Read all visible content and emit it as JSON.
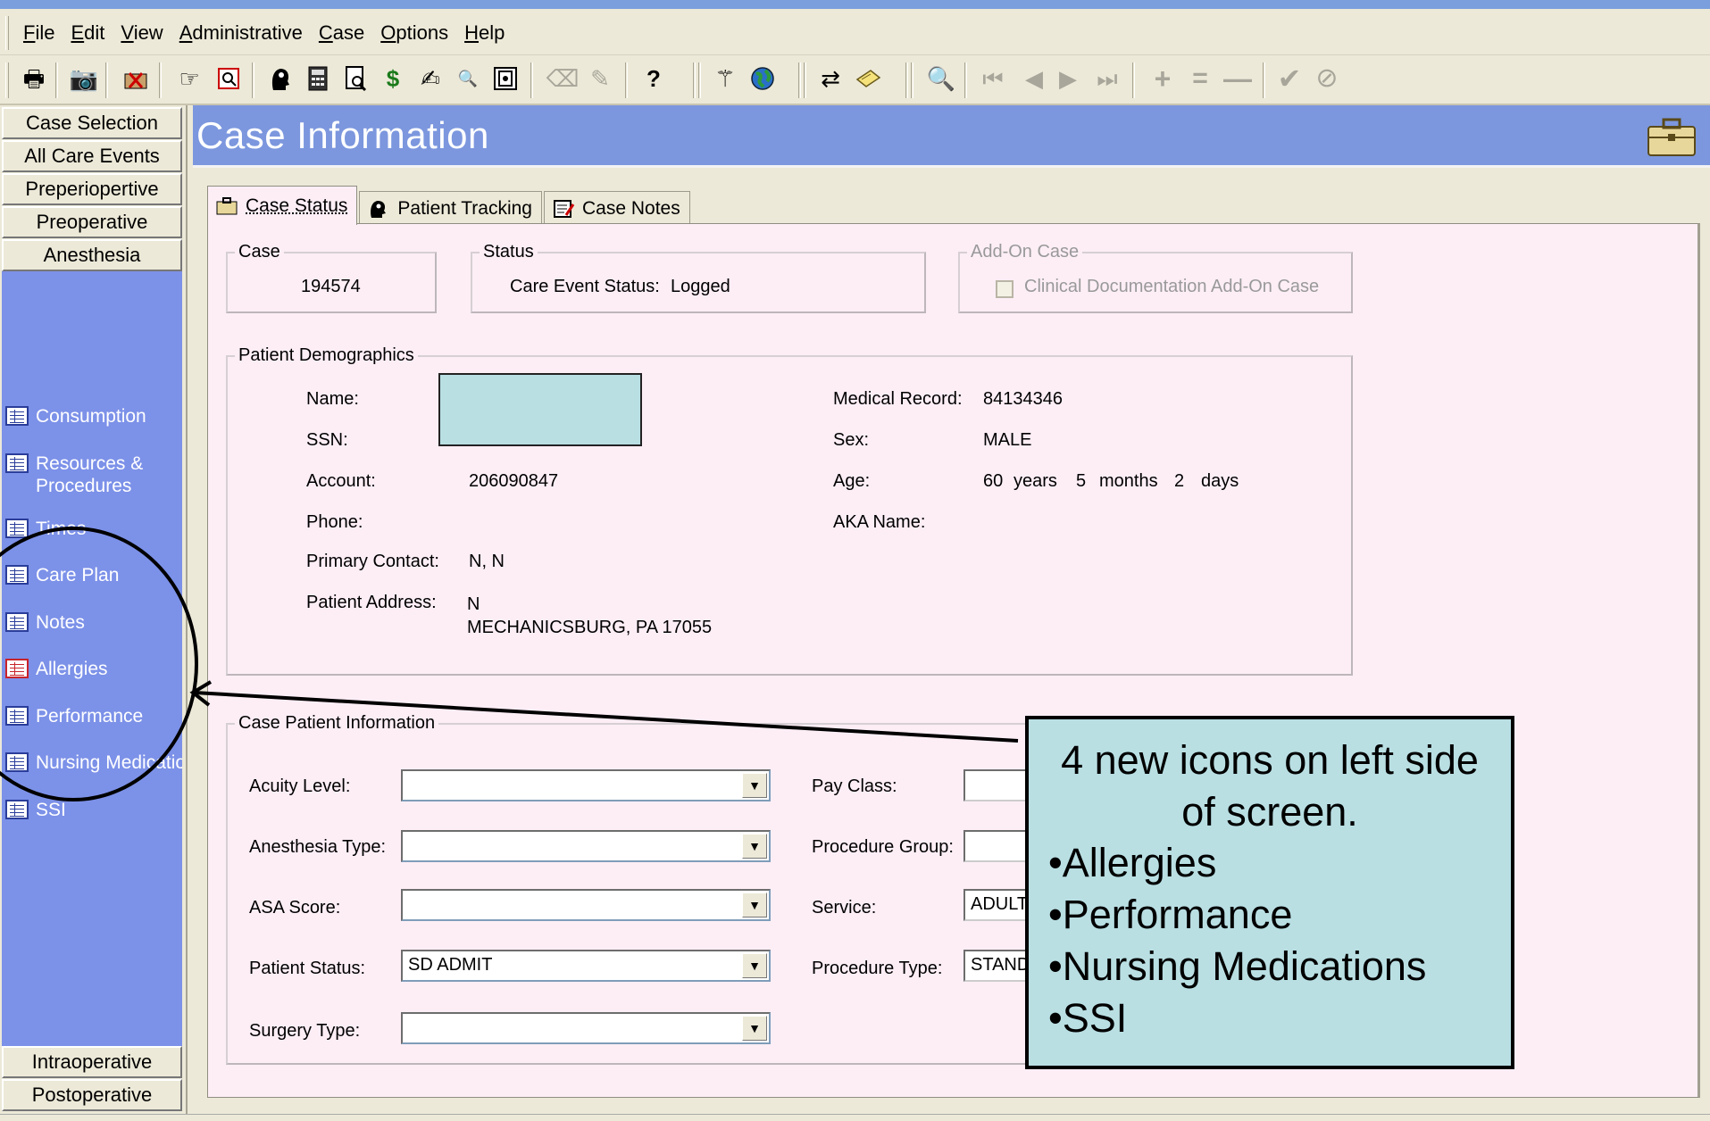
{
  "menu": {
    "items": [
      "File",
      "Edit",
      "View",
      "Administrative",
      "Case",
      "Options",
      "Help"
    ]
  },
  "toolbar": {
    "icons": [
      "printer-icon",
      "camera-icon",
      "cancel-box-icon",
      "hand-pointer-icon",
      "preview-icon",
      "head-silhouette-icon",
      "calculator-icon",
      "document-search-icon",
      "dollar-icon",
      "signature-icon",
      "zoom-tags-icon",
      "document-frame-icon",
      "eraser-icon",
      "pen-disabled-icon",
      "help-question-icon",
      "magic-wand-icon",
      "globe-icon",
      "swap-people-icon",
      "note-pad-icon",
      "search-disabled-icon",
      "first-record-icon",
      "prev-record-icon",
      "next-record-icon",
      "last-record-icon",
      "add-record-icon",
      "equals-icon",
      "delete-record-icon",
      "confirm-check-icon",
      "cancel-circle-icon"
    ]
  },
  "leftnav": {
    "top_buttons": [
      "Case Selection",
      "All Care Events",
      "Preperiopertive",
      "Preoperative",
      "Anesthesia"
    ],
    "items": [
      {
        "label": "Consumption",
        "icon": "grid-list-icon"
      },
      {
        "label": "Resources & Procedures",
        "icon": "grid-list-icon"
      },
      {
        "label": "Times",
        "icon": "grid-list-icon"
      },
      {
        "label": "Care Plan",
        "icon": "grid-list-icon"
      },
      {
        "label": "Notes",
        "icon": "grid-list-icon"
      },
      {
        "label": "Allergies",
        "icon": "allergy-grid-icon"
      },
      {
        "label": "Performance",
        "icon": "grid-list-icon"
      },
      {
        "label": "Nursing Medications",
        "icon": "grid-list-icon"
      },
      {
        "label": "SSI",
        "icon": "grid-list-icon"
      }
    ],
    "bottom_buttons": [
      "Intraoperative",
      "Postoperative"
    ]
  },
  "header": {
    "title": "Case Information"
  },
  "tabs": [
    {
      "label": "Case Status",
      "icon": "briefcase-icon",
      "active": true
    },
    {
      "label": "Patient Tracking",
      "icon": "head-silhouette-icon",
      "active": false
    },
    {
      "label": "Case Notes",
      "icon": "notes-icon",
      "active": false
    }
  ],
  "case_group": {
    "legend": "Case",
    "value": "194574"
  },
  "status_group": {
    "legend": "Status",
    "label": "Care Event Status:",
    "value": "Logged"
  },
  "addon_group": {
    "legend": "Add-On Case",
    "checkbox_label": "Clinical Documentation Add-On Case",
    "checked": false
  },
  "demographics": {
    "legend": "Patient Demographics",
    "name_label": "Name:",
    "ssn_label": "SSN:",
    "account_label": "Account:",
    "account_value": "206090847",
    "phone_label": "Phone:",
    "primary_contact_label": "Primary Contact:",
    "primary_contact_value": "N, N",
    "address_label": "Patient Address:",
    "address_line1": "N",
    "address_line2": "MECHANICSBURG, PA  17055",
    "mrn_label": "Medical Record:",
    "mrn_value": "84134346",
    "sex_label": "Sex:",
    "sex_value": "MALE",
    "age_label": "Age:",
    "age_years": "60",
    "age_years_unit": "years",
    "age_months": "5",
    "age_months_unit": "months",
    "age_days": "2",
    "age_days_unit": "days",
    "aka_label": "AKA Name:"
  },
  "case_patient_info": {
    "legend": "Case Patient Information",
    "acuity_label": "Acuity Level:",
    "acuity_value": "",
    "anesthesia_type_label": "Anesthesia Type:",
    "anesthesia_type_value": "",
    "asa_label": "ASA Score:",
    "asa_value": "",
    "patient_status_label": "Patient Status:",
    "patient_status_value": "SD ADMIT",
    "surgery_type_label": "Surgery Type:",
    "surgery_type_value": "",
    "pay_class_label": "Pay Class:",
    "pay_class_value": "",
    "procedure_group_label": "Procedure Group:",
    "procedure_group_value": "",
    "service_label": "Service:",
    "service_value": "ADULT",
    "procedure_type_label": "Procedure Type:",
    "procedure_type_value": "STANDARD"
  },
  "annotation": {
    "line1": "4 new icons on left side",
    "line2": "of screen.",
    "bullets": [
      "•Allergies",
      "•Performance",
      "•Nursing Medications",
      "•SSI"
    ]
  },
  "colors": {
    "header_blue": "#7c97de",
    "nav_blue": "#7c91e8",
    "panel_pink": "#fdeef6",
    "callout_teal": "#b9dfe3",
    "redacted_box": "#b9dfe3"
  }
}
